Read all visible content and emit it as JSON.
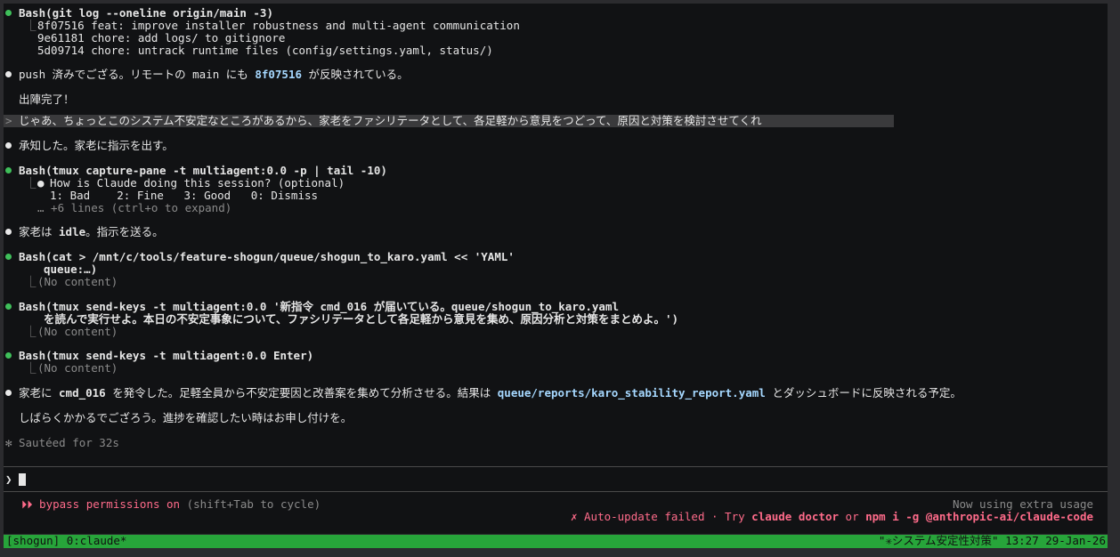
{
  "blocks": {
    "b1": {
      "cmd": "Bash(git log --oneline origin/main -3)",
      "out1": "8f07516 feat: improve installer robustness and multi-agent communication",
      "out2": "9e61181 chore: add logs/ to gitignore",
      "out3": "5d09714 chore: untrack runtime files (config/settings.yaml, status/)"
    },
    "b2": {
      "pre": "push 済みでござる。リモートの main にも ",
      "hash": "8f07516",
      "post": " が反映されている。"
    },
    "b3": {
      "text": "出陣完了！"
    },
    "user": {
      "prompt": ">",
      "text": "じゃあ、ちょっとこのシステム不安定なところがあるから、家老をファシリテータとして、各足軽から意見をつどって、原因と対策を検討させてくれ"
    },
    "b4": {
      "text": "承知した。家老に指示を出す。"
    },
    "b5": {
      "cmd": "Bash(tmux capture-pane -t multiagent:0.0 -p | tail -10)",
      "out1": "How is Claude doing this session? (optional)",
      "out2": "1: Bad    2: Fine   3: Good   0: Dismiss",
      "out3": "… +6 lines (ctrl+o to expand)"
    },
    "b6": {
      "pre": "家老は ",
      "code": "idle",
      "post": "。指示を送る。"
    },
    "b7": {
      "cmd": "Bash(cat > /mnt/c/tools/feature-shogun/queue/shogun_to_karo.yaml << 'YAML'",
      "cont": "queue:…)",
      "out": "(No content)"
    },
    "b8": {
      "cmd": "Bash(tmux send-keys -t multiagent:0.0 '新指令 cmd_016 が届いている。queue/shogun_to_karo.yaml",
      "cont": "を読んで実行せよ。本日の不安定事象について、ファシリテータとして各足軽から意見を集め、原因分析と対策をまとめよ。')",
      "out": "(No content)"
    },
    "b9": {
      "cmd": "Bash(tmux send-keys -t multiagent:0.0 Enter)",
      "out": "(No content)"
    },
    "b10": {
      "pre": "家老に ",
      "code1": "cmd_016",
      "mid": " を発令した。足軽全員から不安定要因と改善案を集めて分析させる。結果は ",
      "path": "queue/reports/karo_stability_report.yaml",
      "post": " とダッシュボードに反映される予定。"
    },
    "b11": {
      "text": "しばらくかかるでござろう。進捗を確認したい時はお申し付けを。"
    },
    "b12": {
      "star": "✻",
      "text": "Sautéed for 32s"
    }
  },
  "input": {
    "prompt": "❯",
    "value": ""
  },
  "footer": {
    "mode_icon": "⏵⏵",
    "mode": "bypass permissions on",
    "mode_hint": "(shift+Tab to cycle)",
    "usage": "Now using extra usage",
    "update_pre": "✗ Auto-update failed · Try ",
    "update_cmd1": "claude doctor",
    "update_mid": " or ",
    "update_cmd2": "npm i -g @anthropic-ai/claude-code"
  },
  "status": {
    "left": "[shogun] 0:claude*",
    "right": "\"✳システム安定性対策\" 13:27 29-Jan-26"
  },
  "colors": {
    "bash_bullet": "#3fbf5a",
    "code": "#a6d8ff",
    "status_bg": "#27a53a",
    "warn": "#ff6b8a"
  }
}
